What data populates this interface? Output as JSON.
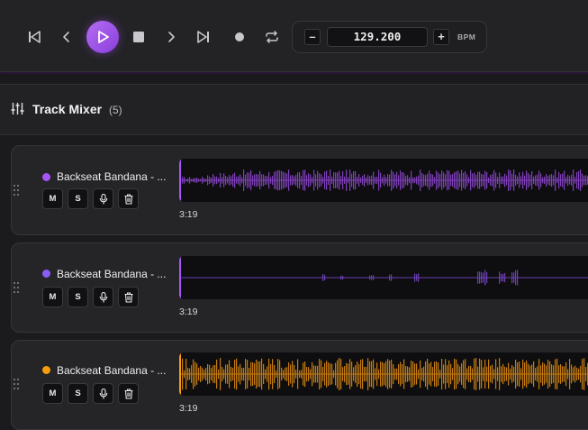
{
  "transport": {
    "buttons": [
      "skip-back",
      "prev",
      "play",
      "stop",
      "next",
      "skip-forward",
      "record",
      "loop"
    ],
    "bpm": {
      "minus_label": "–",
      "value": "129.200",
      "plus_label": "+",
      "unit_label": "BPM"
    }
  },
  "mixer": {
    "title": "Track Mixer",
    "count": "(5)",
    "tracks": [
      {
        "name": "Backseat Bandana - ...",
        "color": "#a855f7",
        "wave_color": "#7e3fb8",
        "duration": "3:19",
        "mute": "M",
        "solo": "S"
      },
      {
        "name": "Backseat Bandana - ...",
        "color": "#8b5cf6",
        "wave_color": "#6b3fb0",
        "duration": "3:19",
        "mute": "M",
        "solo": "S"
      },
      {
        "name": "Backseat Bandana - ...",
        "color": "#f59e0b",
        "wave_color": "#c47a12",
        "duration": "3:19",
        "mute": "M",
        "solo": "S"
      }
    ]
  }
}
